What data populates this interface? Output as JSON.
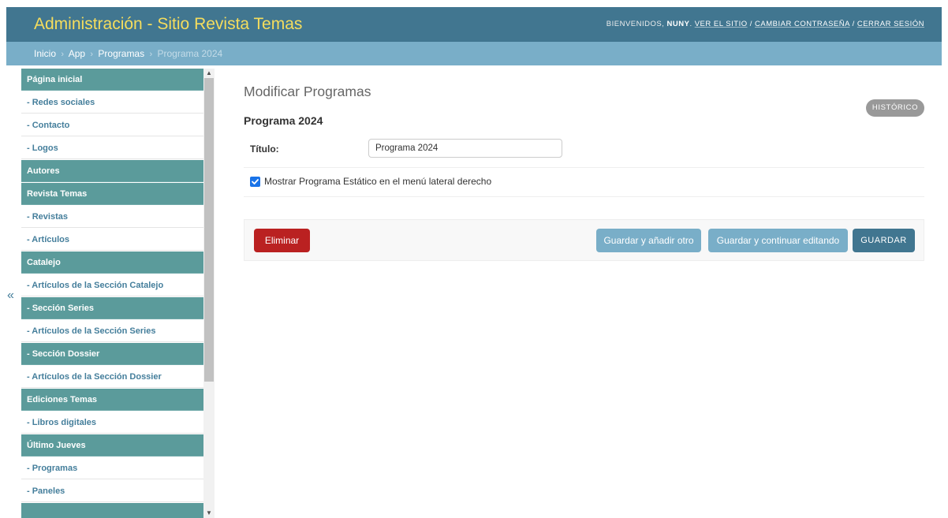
{
  "header": {
    "site_title": "Administración - Sitio Revista Temas",
    "welcome": "BIENVENIDOS,",
    "username": "NUNY",
    "view_site": "VER EL SITIO",
    "change_password": "CAMBIAR CONTRASEÑA",
    "logout": "CERRAR SESIÓN",
    "separator": "/"
  },
  "breadcrumbs": {
    "home": "Inicio",
    "app": "App",
    "model": "Programas",
    "current": "Programa 2024",
    "arrow": "›"
  },
  "sidebar": {
    "toggle": "«",
    "items": [
      {
        "label": "Página inicial",
        "kind": "header"
      },
      {
        "label": "- Redes sociales",
        "kind": "item"
      },
      {
        "label": "- Contacto",
        "kind": "item"
      },
      {
        "label": "- Logos",
        "kind": "item"
      },
      {
        "label": "Autores",
        "kind": "header"
      },
      {
        "label": "Revista Temas",
        "kind": "header"
      },
      {
        "label": "- Revistas",
        "kind": "item"
      },
      {
        "label": "- Artículos",
        "kind": "item"
      },
      {
        "label": "Catalejo",
        "kind": "header"
      },
      {
        "label": "- Artículos de la Sección Catalejo",
        "kind": "item"
      },
      {
        "label": "- Sección Series",
        "kind": "highlight"
      },
      {
        "label": "- Artículos de la Sección Series",
        "kind": "item"
      },
      {
        "label": "- Sección Dossier",
        "kind": "highlight"
      },
      {
        "label": "- Artículos de la Sección Dossier",
        "kind": "item"
      },
      {
        "label": "Ediciones Temas",
        "kind": "header"
      },
      {
        "label": "- Libros digitales",
        "kind": "item"
      },
      {
        "label": "Último Jueves",
        "kind": "header"
      },
      {
        "label": "- Programas",
        "kind": "item"
      },
      {
        "label": "- Paneles",
        "kind": "item"
      },
      {
        "label": "",
        "kind": "header"
      }
    ]
  },
  "main": {
    "title": "Modificar Programas",
    "history_label": "HISTÓRICO",
    "object_title": "Programa 2024",
    "fields": {
      "titulo_label": "Título:",
      "titulo_value": "Programa 2024",
      "checkbox_label": "Mostrar Programa Estático en el menú lateral derecho",
      "checkbox_checked": true
    },
    "buttons": {
      "delete": "Eliminar",
      "save_add": "Guardar y añadir otro",
      "save_continue": "Guardar y continuar editando",
      "save": "GUARDAR"
    }
  },
  "colors": {
    "header_bg": "#417690",
    "breadcrumb_bg": "#79aec8",
    "title_yellow": "#f5dd5d",
    "sidebar_header_bg": "#5b9b9b",
    "link_blue": "#447e9b",
    "delete_red": "#ba2121",
    "history_gray": "#999999"
  }
}
